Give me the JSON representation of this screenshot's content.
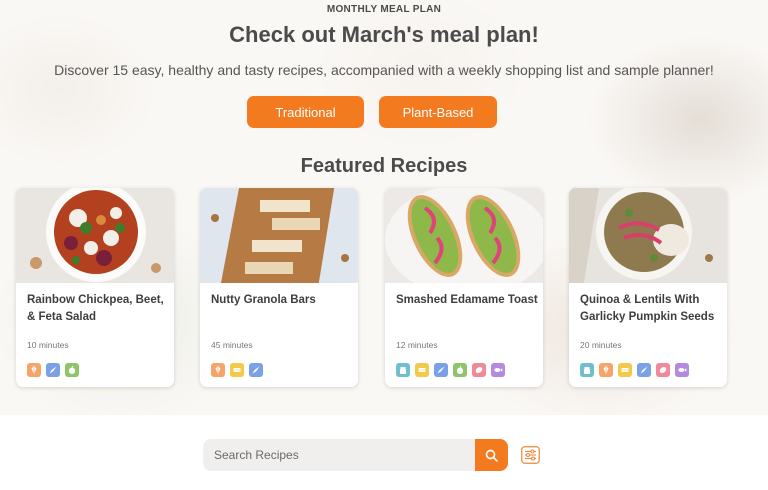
{
  "header": {
    "eyebrow": "MONTHLY MEAL PLAN",
    "title": "Check out March's meal plan!",
    "subtitle": "Discover 15 easy, healthy and tasty recipes, accompanied with a weekly shopping list and sample planner!"
  },
  "plans": {
    "traditional_label": "Traditional",
    "plant_based_label": "Plant-Based"
  },
  "featured": {
    "heading": "Featured Recipes",
    "recipes": [
      {
        "name": "Rainbow Chickpea, Beet, & Feta Salad",
        "time": "10 minutes",
        "tags": [
          "bread-icon",
          "carrot-icon",
          "apple-icon"
        ]
      },
      {
        "name": "Nutty Granola Bars",
        "time": "45 minutes",
        "tags": [
          "bread-icon",
          "cheese-icon",
          "carrot-icon"
        ]
      },
      {
        "name": "Smashed Edamame Toast",
        "time": "12 minutes",
        "tags": [
          "jar-icon",
          "cheese-icon",
          "carrot-icon",
          "apple-icon",
          "meat-icon",
          "fish-icon"
        ]
      },
      {
        "name": "Quinoa & Lentils With Garlicky Pumpkin Seeds",
        "time": "20 minutes",
        "tags": [
          "jar-icon",
          "bread-icon",
          "cheese-icon",
          "carrot-icon",
          "meat-icon",
          "fish-icon"
        ]
      }
    ]
  },
  "tag_colors": {
    "jar-icon": "#6fbfcf",
    "bread-icon": "#f5a46a",
    "cheese-icon": "#f4c94a",
    "carrot-icon": "#7aa1e8",
    "apple-icon": "#8fc46a",
    "meat-icon": "#f08a9a",
    "fish-icon": "#b48ae0"
  },
  "search": {
    "placeholder": "Search Recipes"
  },
  "colors": {
    "accent": "#f47a20",
    "heading": "#4b4b4b"
  }
}
